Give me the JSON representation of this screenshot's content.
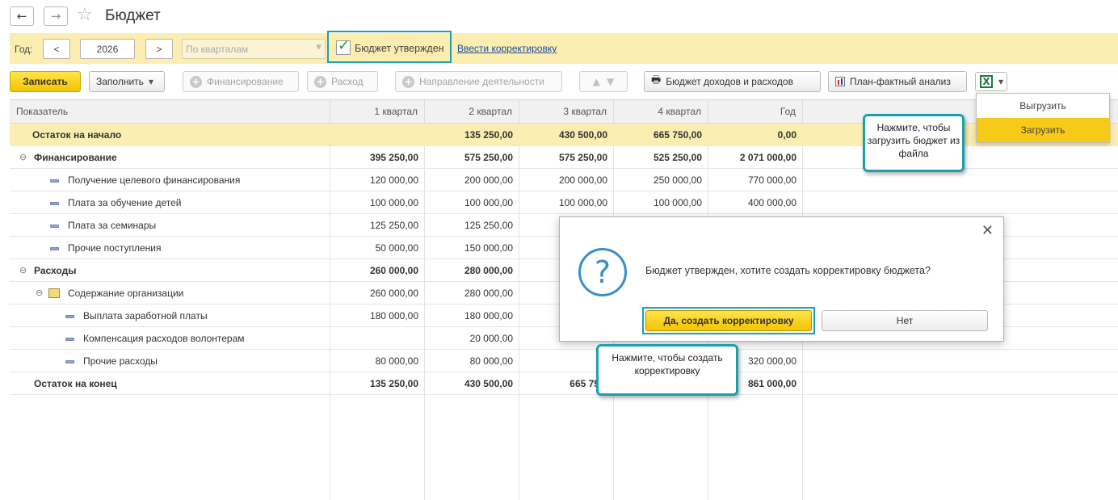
{
  "window": {
    "title": "Бюджет"
  },
  "filters": {
    "year_label": "Год:",
    "prev": "<",
    "year": "2026",
    "next": ">",
    "period": "По кварталам",
    "approved_label": "Бюджет утвержден",
    "approved_checked": true,
    "correction_link": "Ввести корректировку"
  },
  "toolbar": {
    "save": "Записать",
    "fill": "Заполнить",
    "financing": "Финансирование",
    "expense": "Расход",
    "activity": "Направление деятельности",
    "income_expense_budget": "Бюджет доходов и расходов",
    "plan_fact": "План-фактный анализ"
  },
  "excel_menu": {
    "export": "Выгрузить",
    "import": "Загрузить",
    "active": "import"
  },
  "table": {
    "columns": [
      "Показатель",
      "1 квартал",
      "2 квартал",
      "3 квартал",
      "4 квартал",
      "Год"
    ],
    "rows": [
      {
        "name": "Остаток на начало",
        "q1": "",
        "q2": "135 250,00",
        "q3": "430 500,00",
        "q4": "665 750,00",
        "year": "0,00"
      },
      {
        "name": "Финансирование",
        "q1": "395 250,00",
        "q2": "575 250,00",
        "q3": "575 250,00",
        "q4": "525 250,00",
        "year": "2 071 000,00"
      },
      {
        "name": "Получение целевого финансирования",
        "q1": "120 000,00",
        "q2": "200 000,00",
        "q3": "200 000,00",
        "q4": "250 000,00",
        "year": "770 000,00"
      },
      {
        "name": "Плата за обучение детей",
        "q1": "100 000,00",
        "q2": "100 000,00",
        "q3": "100 000,00",
        "q4": "100 000,00",
        "year": "400 000,00"
      },
      {
        "name": "Плата за семинары",
        "q1": "125 250,00",
        "q2": "125 250,00",
        "q3": "",
        "q4": "",
        "year": ""
      },
      {
        "name": "Прочие поступления",
        "q1": "50 000,00",
        "q2": "150 000,00",
        "q3": "",
        "q4": "",
        "year": ""
      },
      {
        "name": "Расходы",
        "q1": "260 000,00",
        "q2": "280 000,00",
        "q3": "",
        "q4": "",
        "year": ""
      },
      {
        "name": "Содержание организации",
        "q1": "260 000,00",
        "q2": "280 000,00",
        "q3": "",
        "q4": "",
        "year": ""
      },
      {
        "name": "Выплата заработной платы",
        "q1": "180 000,00",
        "q2": "180 000,00",
        "q3": "",
        "q4": "",
        "year": ""
      },
      {
        "name": "Компенсация расходов волонтерам",
        "q1": "",
        "q2": "20 000,00",
        "q3": "",
        "q4": "",
        "year": ""
      },
      {
        "name": "Прочие расходы",
        "q1": "80 000,00",
        "q2": "80 000,00",
        "q3": "",
        "q4": "",
        "year": "320 000,00"
      },
      {
        "name": "Остаток на конец",
        "q1": "135 250,00",
        "q2": "430 500,00",
        "q3": "665 750,",
        "q4": "",
        "year": "861 000,00"
      }
    ]
  },
  "dialog": {
    "message": "Бюджет утвержден, хотите создать корректировку бюджета?",
    "yes": "Да, создать корректировку",
    "no": "Нет"
  },
  "callouts": {
    "import_hint": "Нажмите, чтобы загрузить бюджет из файла",
    "correction_hint": "Нажмите, чтобы создать корректировку"
  },
  "colors": {
    "accent_yellow": "#f3c400",
    "highlight_frame": "#1ba0b0",
    "band": "#fbeeb0"
  }
}
